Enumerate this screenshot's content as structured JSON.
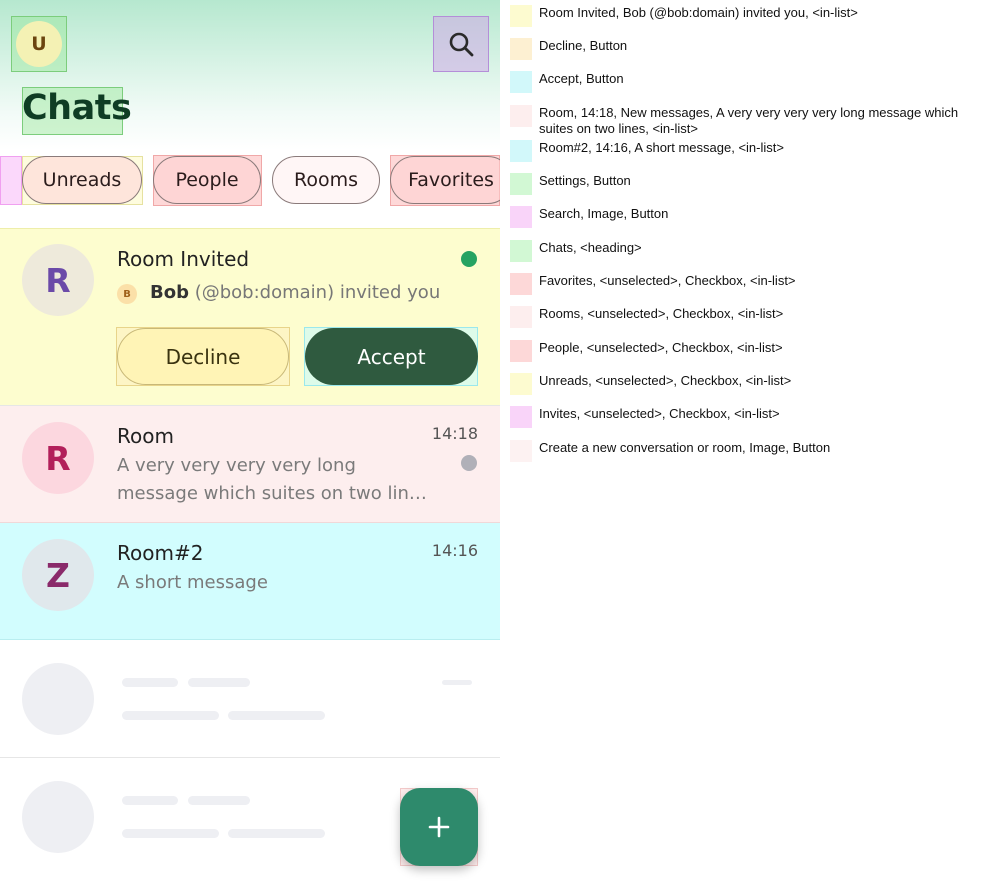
{
  "header": {
    "user_avatar_letter": "U",
    "title": "Chats",
    "search_icon": "search-icon"
  },
  "filters": [
    {
      "label": "Unreads",
      "selected": false
    },
    {
      "label": "People",
      "selected": false
    },
    {
      "label": "Rooms",
      "selected": false
    },
    {
      "label": "Favorites",
      "selected": false
    }
  ],
  "invite": {
    "avatar_letter": "R",
    "name": "Room Invited",
    "inviter_avatar_letter": "B",
    "inviter_name": "Bob",
    "invite_text": " (@bob:domain) invited you",
    "unread_color": "#26a362",
    "decline_label": "Decline",
    "accept_label": "Accept"
  },
  "rooms": [
    {
      "avatar_letter": "R",
      "name": "Room",
      "time": "14:18",
      "message_line1": "A very very very very long",
      "message_line2": "message which suites on two lin…",
      "indicator_color": "#b0b0b8"
    },
    {
      "avatar_letter": "Z",
      "name": "Room#2",
      "time": "14:16",
      "message": "A short message"
    }
  ],
  "fab": {
    "icon": "plus-icon"
  },
  "legend": [
    {
      "text": "Room Invited, Bob (@bob:domain) invited you, <in-list>",
      "color": "#fdfbd0"
    },
    {
      "text": "Decline, Button",
      "color": "#fdf0d2"
    },
    {
      "text": "Accept, Button",
      "color": "#d2f8fa"
    },
    {
      "text": "Room, 14:18, New messages, A very very very very long message which suites on two lines, <in-list>",
      "color": "#fdeeee"
    },
    {
      "text": "Room#2, 14:16, A short message, <in-list>",
      "color": "#d2f8fa"
    },
    {
      "text": "Settings, Button",
      "color": "#d2f8d4"
    },
    {
      "text": "Search, Image, Button",
      "color": "#f9d4f9"
    },
    {
      "text": "Chats, <heading>",
      "color": "#d2f8d4"
    },
    {
      "text": "Favorites, <unselected>, Checkbox, <in-list>",
      "color": "#fdd8d8"
    },
    {
      "text": "Rooms, <unselected>, Checkbox, <in-list>",
      "color": "#fdeeee"
    },
    {
      "text": "People, <unselected>, Checkbox, <in-list>",
      "color": "#fdd8d8"
    },
    {
      "text": "Unreads, <unselected>, Checkbox, <in-list>",
      "color": "#fdfbd0"
    },
    {
      "text": "Invites, <unselected>, Checkbox, <in-list>",
      "color": "#f9d4f9"
    },
    {
      "text": "Create a new conversation or room, Image, Button",
      "color": "#fdf2f2"
    }
  ]
}
